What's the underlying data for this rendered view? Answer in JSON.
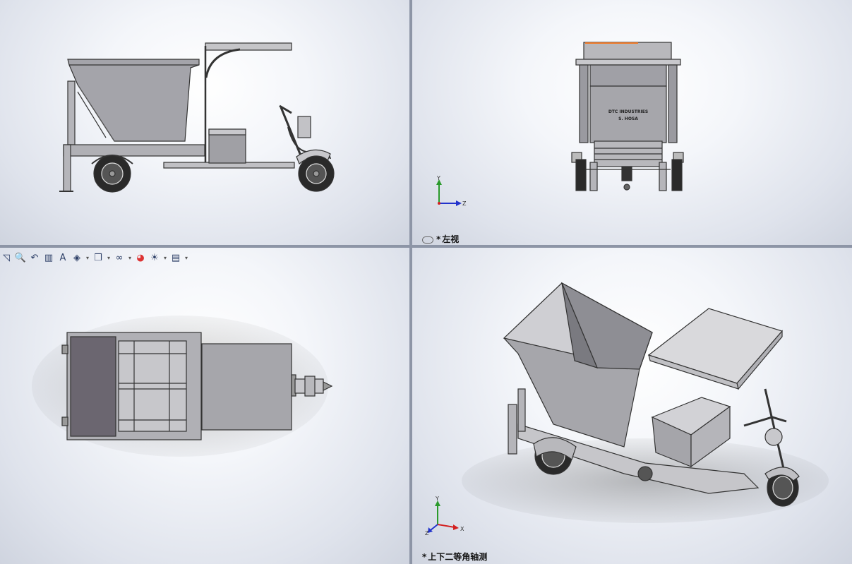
{
  "viewports": {
    "top_left": {
      "label": ""
    },
    "top_right": {
      "label": "左视",
      "modified_marker": "*"
    },
    "bottom_left": {
      "label": ""
    },
    "bottom_right": {
      "label": "上下二等角轴测",
      "modified_marker": "*"
    }
  },
  "model": {
    "rear_panel_text_line1": "DTC INDUSTRIES",
    "rear_panel_text_line2": "S. HOSA"
  },
  "triad": {
    "x": "X",
    "y": "Y",
    "z": "Z"
  },
  "heads_up_toolbar": {
    "items": [
      "zoom-to-fit-icon",
      "zoom-to-area-icon",
      "previous-view-icon",
      "section-view-icon",
      "dynamic-annotation-icon",
      "view-orientation-icon",
      "display-style-icon",
      "hide-show-items-icon",
      "edit-appearance-icon",
      "apply-scene-icon",
      "view-settings-icon"
    ]
  },
  "colors": {
    "accent_orange": "#f07b2a",
    "model_gray": "#a8a8ad",
    "dark_panel": "#6b6670",
    "axis_x": "#d32020",
    "axis_y": "#2b9a2b",
    "axis_z": "#2233cc"
  }
}
